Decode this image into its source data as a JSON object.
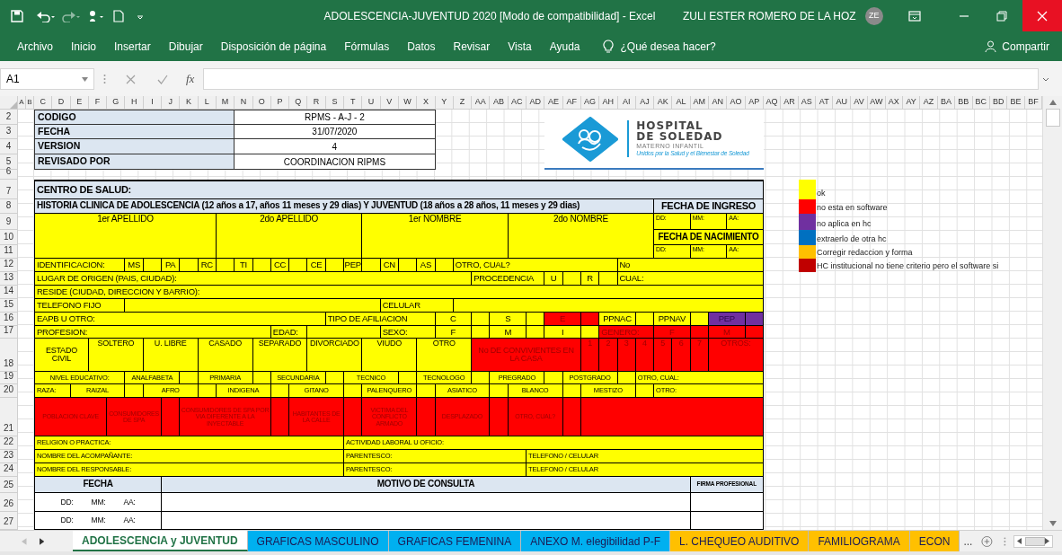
{
  "title_bar": {
    "title": "ADOLESCENCIA-JUVENTUD 2020 [Modo de compatibilidad] - Excel",
    "user": "ZULI ESTER ROMERO DE LA HOZ",
    "initials": "ZE"
  },
  "menu": [
    "Archivo",
    "Inicio",
    "Insertar",
    "Dibujar",
    "Disposición de página",
    "Fórmulas",
    "Datos",
    "Revisar",
    "Vista",
    "Ayuda"
  ],
  "tell_me": {
    "placeholder": "¿Qué desea hacer?"
  },
  "share": "Compartir",
  "formula_bar": {
    "name_box": "A1",
    "function_label": "fx"
  },
  "columns": [
    "A",
    "B",
    "C",
    "D",
    "E",
    "F",
    "G",
    "H",
    "I",
    "J",
    "K",
    "L",
    "M",
    "N",
    "O",
    "P",
    "Q",
    "R",
    "S",
    "T",
    "U",
    "V",
    "W",
    "X",
    "Y",
    "Z",
    "AA",
    "AB",
    "AC",
    "AD",
    "AE",
    "AF",
    "AG",
    "AH",
    "AI",
    "AJ",
    "AK",
    "AL",
    "AM",
    "AN",
    "AO",
    "AP",
    "AQ",
    "AR",
    "AS",
    "AT",
    "AU",
    "AV",
    "AW",
    "AX",
    "AY",
    "AZ",
    "BA",
    "BB",
    "BC",
    "BD",
    "BE",
    "BF"
  ],
  "row_numbers": [
    "2",
    "3",
    "4",
    "5",
    "6",
    "7",
    "8",
    "9",
    "10",
    "11",
    "12",
    "13",
    "14",
    "15",
    "16",
    "17",
    "18",
    "19",
    "20",
    "21",
    "22",
    "23",
    "24",
    "25",
    "26",
    "27"
  ],
  "header_table": [
    {
      "label": "CODIGO",
      "value": "RPMS - A-J - 2"
    },
    {
      "label": "FECHA",
      "value": "31/07/2020"
    },
    {
      "label": "VERSION",
      "value": "4"
    },
    {
      "label": "REVISADO POR",
      "value": "COORDINACION RIPMS"
    }
  ],
  "logo": {
    "name": "HOSPITAL",
    "name_line2": "DE SOLEDAD",
    "subtitle": "MATERNO INFANTIL",
    "slogan": "Unidos por la Salud y el Bienestar de Soledad"
  },
  "form_rows": [
    {
      "cells": [
        {
          "text": "CENTRO DE SALUD:",
          "color": "#dce6f1"
        }
      ]
    },
    {
      "cells": [
        {
          "text": "HISTORIA CLINICA DE ADOLESCENCIA (12 años a 17, años 11 meses y 29 dias) Y JUVENTUD (18 años a 28 años, 11 meses y 29 dias)",
          "color": "#dce6f1"
        },
        {
          "text": "FECHA DE INGRESO",
          "color": "#dce6f1"
        }
      ]
    },
    {
      "cells": [
        {
          "text": "1er APELLIDO",
          "color": "#ffff00"
        },
        {
          "text": "2do APELLIDO",
          "color": "#ffff00"
        },
        {
          "text": "1er NOMBRE",
          "color": "#ffff00"
        },
        {
          "text": "2do NOMBRE",
          "color": "#ffff00"
        },
        {
          "text": "DD:",
          "color": "#ffff00"
        },
        {
          "text": "MM:",
          "color": "#ffff00"
        },
        {
          "text": "AA:",
          "color": "#ffff00"
        },
        {
          "text": "FECHA DE NACIMIENTO",
          "color": "#ffff00"
        },
        {
          "text": "DD:",
          "color": "#ffff00"
        },
        {
          "text": "MM:",
          "color": "#ffff00"
        },
        {
          "text": "AA:",
          "color": "#ffff00"
        }
      ]
    },
    {
      "cells": [
        {
          "text": "IDENTIFICACION:",
          "color": "#ffff00"
        },
        {
          "text": "MS",
          "color": "#ffff00"
        },
        {
          "color": "#ffff00"
        },
        {
          "text": "PA",
          "color": "#ffff00"
        },
        {
          "color": "#ffff00"
        },
        {
          "text": "RC",
          "color": "#ffff00"
        },
        {
          "color": "#ffff00"
        },
        {
          "text": "TI",
          "color": "#ffff00"
        },
        {
          "color": "#ffff00"
        },
        {
          "text": "CC",
          "color": "#ffff00"
        },
        {
          "color": "#ffff00"
        },
        {
          "text": "CE",
          "color": "#ffff00"
        },
        {
          "color": "#ffff00"
        },
        {
          "text": "PEP",
          "color": "#ffff00"
        },
        {
          "color": "#ffff00"
        },
        {
          "text": "CN",
          "color": "#ffff00"
        },
        {
          "color": "#ffff00"
        },
        {
          "text": "AS",
          "color": "#ffff00"
        },
        {
          "color": "#ffff00"
        },
        {
          "text": "OTRO, CUAL?",
          "color": "#ffff00"
        },
        {
          "text": "No",
          "color": "#ffff00"
        }
      ]
    },
    {
      "cells": [
        {
          "text": "LUGAR DE ORIGEN (PAIS, CIUDAD):",
          "color": "#ffff00"
        },
        {
          "text": "PROCEDENCIA",
          "color": "#ffff00"
        },
        {
          "text": "U",
          "color": "#ffff00"
        },
        {
          "color": "#ffff00"
        },
        {
          "text": "R",
          "color": "#ffff00"
        },
        {
          "color": "#ffff00"
        },
        {
          "text": "CUAL:",
          "color": "#ffff00"
        }
      ]
    },
    {
      "cells": [
        {
          "text": "RESIDE (CIUDAD, DIRECCION Y BARRIO):",
          "color": "#ffff00"
        }
      ]
    },
    {
      "cells": [
        {
          "text": "TELEFONO FIJO",
          "color": "#ffff00"
        },
        {
          "color": "#ffff00"
        },
        {
          "text": "CELULAR",
          "color": "#ffff00"
        },
        {
          "color": "#ffff00"
        }
      ]
    },
    {
      "cells": [
        {
          "text": "EAPB U OTRO:",
          "color": "#ffff00"
        },
        {
          "text": "TIPO DE AFILIACION",
          "color": "#ffff00"
        },
        {
          "text": "C",
          "color": "#ffff00"
        },
        {
          "color": "#ffff00"
        },
        {
          "text": "S",
          "color": "#ffff00"
        },
        {
          "color": "#ffff00"
        },
        {
          "text": "E",
          "color": "#ff0000"
        },
        {
          "color": "#ff0000"
        },
        {
          "text": "PPNAC",
          "color": "#ffff00"
        },
        {
          "color": "#ffff00"
        },
        {
          "text": "PPNAV",
          "color": "#ffff00"
        },
        {
          "color": "#ffff00"
        },
        {
          "text": "PEP",
          "color": "#7030a0"
        },
        {
          "color": "#7030a0"
        }
      ]
    },
    {
      "cells": [
        {
          "text": "PROFESION:",
          "color": "#ffff00"
        },
        {
          "text": "EDAD:",
          "color": "#ffff00"
        },
        {
          "color": "#ffff00"
        },
        {
          "text": "SEXO:",
          "color": "#ffff00"
        },
        {
          "text": "F",
          "color": "#ffff00"
        },
        {
          "color": "#ffff00"
        },
        {
          "text": "M",
          "color": "#ffff00"
        },
        {
          "color": "#ffff00"
        },
        {
          "text": "I",
          "color": "#ffff00"
        },
        {
          "color": "#ffff00"
        },
        {
          "text": "GENERO:",
          "color": "#ff0000"
        },
        {
          "text": "F",
          "color": "#ff0000"
        },
        {
          "color": "#ff0000"
        },
        {
          "text": "M",
          "color": "#ff0000"
        },
        {
          "color": "#ff0000"
        }
      ]
    },
    {
      "cells": [
        {
          "text": "ESTADO CIVIL",
          "color": "#ffff00"
        },
        {
          "text": "SOLTERO",
          "color": "#ffff00"
        },
        {
          "text": "U. LIBRE",
          "color": "#ffff00"
        },
        {
          "text": "CASADO",
          "color": "#ffff00"
        },
        {
          "text": "SEPARADO",
          "color": "#ffff00"
        },
        {
          "text": "DIVORCIADO",
          "color": "#ffff00"
        },
        {
          "text": "VIUDO",
          "color": "#ffff00"
        },
        {
          "text": "OTRO",
          "color": "#ffff00"
        },
        {
          "text": "No DE CONVIVIENTES EN LA CASA",
          "color": "#ff0000"
        },
        {
          "text": "1",
          "color": "#ff0000"
        },
        {
          "text": "2",
          "color": "#ff0000"
        },
        {
          "text": "3",
          "color": "#ff0000"
        },
        {
          "text": "4",
          "color": "#ff0000"
        },
        {
          "text": "5",
          "color": "#ff0000"
        },
        {
          "text": "6",
          "color": "#ff0000"
        },
        {
          "text": "7",
          "color": "#ff0000"
        },
        {
          "text": "OTROS:",
          "color": "#ff0000"
        }
      ]
    },
    {
      "cells": [
        {
          "text": "NIVEL EDUCATIVO:",
          "color": "#ffff00"
        },
        {
          "text": "ANALFABETA",
          "color": "#ffff00"
        },
        {
          "color": "#ffff00"
        },
        {
          "text": "PRIMARIA",
          "color": "#ffff00"
        },
        {
          "color": "#ffff00"
        },
        {
          "text": "SECUNDARIA",
          "color": "#ffff00"
        },
        {
          "color": "#ffff00"
        },
        {
          "text": "TECNICO",
          "color": "#ffff00"
        },
        {
          "color": "#ffff00"
        },
        {
          "text": "TECNOLOGO",
          "color": "#ffff00"
        },
        {
          "color": "#ffff00"
        },
        {
          "text": "PREGRADO",
          "color": "#ffff00"
        },
        {
          "color": "#ffff00"
        },
        {
          "text": "POSTGRADO",
          "color": "#ffff00"
        },
        {
          "color": "#ffff00"
        },
        {
          "text": "OTRO, CUAL:",
          "color": "#ffff00"
        }
      ]
    },
    {
      "cells": [
        {
          "text": "RAZA:",
          "color": "#ffff00"
        },
        {
          "text": "RAIZAL",
          "color": "#ffff00"
        },
        {
          "color": "#ffff00"
        },
        {
          "text": "AFRO",
          "color": "#ffff00"
        },
        {
          "color": "#ffff00"
        },
        {
          "text": "INDIGENA",
          "color": "#ffff00"
        },
        {
          "color": "#ffff00"
        },
        {
          "text": "GITANO",
          "color": "#ffff00"
        },
        {
          "color": "#ffff00"
        },
        {
          "text": "PALENQUERO",
          "color": "#ffff00"
        },
        {
          "color": "#ffff00"
        },
        {
          "text": "ASIATICO",
          "color": "#ffff00"
        },
        {
          "color": "#ffff00"
        },
        {
          "text": "BLANCO",
          "color": "#ffff00"
        },
        {
          "color": "#ffff00"
        },
        {
          "text": "MESTIZO",
          "color": "#ffff00"
        },
        {
          "color": "#ffff00"
        },
        {
          "text": "OTRO:",
          "color": "#ffff00"
        }
      ]
    },
    {
      "cells": [
        {
          "text": "POBLACION CLAVE",
          "color": "#ff0000"
        },
        {
          "text": "CONSUMIDORES DE SPA",
          "color": "#ff0000"
        },
        {
          "color": "#ff0000"
        },
        {
          "text": "CONSUMIDORES DE SPA POR VIA DIFERENTE A LA INYECTABLE",
          "color": "#ff0000"
        },
        {
          "color": "#ff0000"
        },
        {
          "text": "HABITANTES DE LA CALLE",
          "color": "#ff0000"
        },
        {
          "color": "#ff0000"
        },
        {
          "text": "VICTIMA DEL CONFLICTO ARMADO",
          "color": "#ff0000"
        },
        {
          "color": "#ff0000"
        },
        {
          "text": "DESPLAZADO",
          "color": "#ff0000"
        },
        {
          "color": "#ff0000"
        },
        {
          "text": "OTRO, CUAL?",
          "color": "#ff0000"
        },
        {
          "color": "#ff0000"
        },
        {
          "color": "#ff0000"
        }
      ]
    },
    {
      "cells": [
        {
          "text": "RELIGION O PRACTICA:",
          "color": "#ffff00"
        },
        {
          "text": "ACTIVIDAD LABORAL U OFICIO:",
          "color": "#ffff00"
        }
      ]
    },
    {
      "cells": [
        {
          "text": "NOMBRE DEL ACOMPAÑANTE:",
          "color": "#ffff00"
        },
        {
          "text": "PARENTESCO:",
          "color": "#ffff00"
        },
        {
          "text": "TELEFONO / CELULAR",
          "color": "#ffff00"
        }
      ]
    },
    {
      "cells": [
        {
          "text": "NOMBRE DEL RESPONSABLE:",
          "color": "#ffff00"
        },
        {
          "text": "PARENTESCO:",
          "color": "#ffff00"
        },
        {
          "text": "TELEFONO / CELULAR",
          "color": "#ffff00"
        }
      ]
    },
    {
      "cells": [
        {
          "text": "FECHA",
          "color": "#dce6f1"
        },
        {
          "text": "MOTIVO DE CONSULTA",
          "color": "#dce6f1"
        },
        {
          "text": "FIRMA PROFESIONAL",
          "color": "#dce6f1"
        }
      ]
    },
    {
      "cells": [
        {
          "parts": [
            "DD:",
            "MM:",
            "AA:"
          ],
          "color": "#ffffff"
        },
        {
          "color": "#ffffff"
        },
        {
          "color": "#ffffff"
        }
      ]
    },
    {
      "cells": [
        {
          "parts": [
            "DD:",
            "MM:",
            "AA:"
          ],
          "color": "#ffffff"
        },
        {
          "color": "#ffffff"
        },
        {
          "color": "#ffffff"
        }
      ]
    }
  ],
  "legend": [
    {
      "label": "ok",
      "color": "#ffff00"
    },
    {
      "label": "no esta en software",
      "color": "#ff0000"
    },
    {
      "label": "no aplica en hc",
      "color": "#7030a0"
    },
    {
      "label": "extraerlo de otra hc",
      "color": "#0070c0"
    },
    {
      "label": "Corregir redaccion y forma",
      "color": "#ffc000"
    },
    {
      "label": "HC institucional no tiene criterio pero el software si",
      "color": "#c00000"
    }
  ],
  "sheet_tabs": [
    {
      "label": "ADOLESCENCIA y JUVENTUD",
      "selected": true,
      "color": "#ffffff"
    },
    {
      "label": "GRAFICAS MASCULINO",
      "selected": false,
      "color": "#00b0f0"
    },
    {
      "label": "GRAFICAS FEMENINA",
      "selected": false,
      "color": "#00b0f0"
    },
    {
      "label": "ANEXO M. elegibilidad P-F",
      "selected": false,
      "color": "#00b0f0"
    },
    {
      "label": "L. CHEQUEO AUDITIVO",
      "selected": false,
      "color": "#ffc000"
    },
    {
      "label": "FAMILIOGRAMA",
      "selected": false,
      "color": "#ffc000"
    },
    {
      "label": "ECON",
      "selected": false,
      "color": "#ffc000"
    }
  ],
  "more_tabs": "..."
}
